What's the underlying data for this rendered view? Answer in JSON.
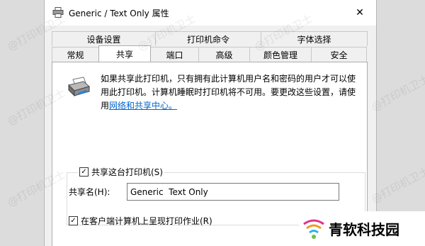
{
  "window": {
    "title": "Generic / Text Only 属性",
    "close_glyph": "✕"
  },
  "tabs": {
    "back_row": [
      "设备设置",
      "打印机命令",
      "字体选择"
    ],
    "front_row": [
      "常规",
      "共享",
      "端口",
      "高级",
      "颜色管理",
      "安全"
    ],
    "active": "共享"
  },
  "info": {
    "line1": "如果共享此打印机，只有拥有此计算机用户名和密码的用户才可以使",
    "line2": "用此打印机。计算机睡眠时打印机将不可用。要更改这些设置，请使",
    "line3_prefix": "用",
    "link": "网络和共享中心。"
  },
  "share": {
    "checkbox_label": "共享这台打印机(S)",
    "checkbox_checked": true,
    "name_label": "共享名(H):",
    "name_value": "Generic  Text Only",
    "render_label": "在客户端计算机上呈现打印作业(R)",
    "render_checked": true
  },
  "watermark": {
    "text": "@打印机卫士"
  },
  "brand": {
    "text": "青软科技园"
  }
}
